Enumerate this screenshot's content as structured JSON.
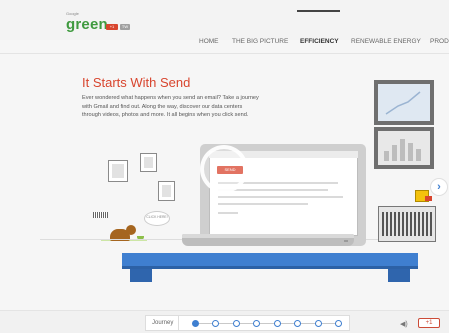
{
  "header": {
    "logo_small": "Google",
    "logo_main": "green",
    "badges": [
      "+1",
      "TW"
    ]
  },
  "nav": {
    "items": [
      "HOME",
      "THE BIG PICTURE",
      "EFFICIENCY",
      "RENEWABLE ENERGY",
      "PROD"
    ],
    "active": "EFFICIENCY"
  },
  "intro": {
    "title": "It Starts With Send",
    "body": "Ever wondered what happens when you send an email? Take a journey with Gmail and find out. Along the way, discover our data centers through videos, photos and more. It all begins when you click send."
  },
  "scene": {
    "send_label": "SEND",
    "bubble_text": "CLICK HERE!",
    "next_icon": "chevron-right-icon"
  },
  "footer": {
    "journey_label": "Journey",
    "journey_total_steps": 8,
    "journey_current_step": 1,
    "sound_icon": "speaker-icon",
    "gplus_label": "+1"
  },
  "colors": {
    "accent_red": "#d8452e",
    "desk_blue": "#3f7fd0",
    "logo_green": "#3f9a3f"
  }
}
